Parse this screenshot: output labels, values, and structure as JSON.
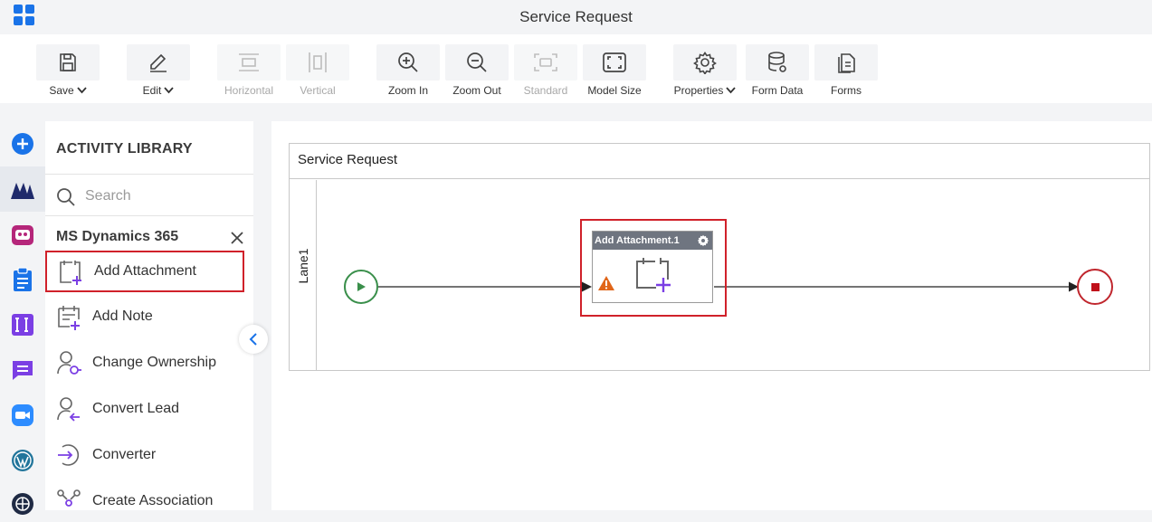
{
  "app": {
    "title": "Service Request"
  },
  "toolbar": {
    "save": "Save",
    "edit": "Edit",
    "horizontal": "Horizontal",
    "vertical": "Vertical",
    "zoom_in": "Zoom In",
    "zoom_out": "Zoom Out",
    "standard": "Standard",
    "model_size": "Model Size",
    "properties": "Properties",
    "form_data": "Form Data",
    "forms": "Forms"
  },
  "library": {
    "title": "ACTIVITY LIBRARY",
    "search_placeholder": "Search",
    "category": "MS Dynamics 365",
    "items": [
      {
        "label": "Add Attachment",
        "icon": "add-attachment-icon",
        "selected": true
      },
      {
        "label": "Add Note",
        "icon": "add-note-icon"
      },
      {
        "label": "Change Ownership",
        "icon": "change-ownership-icon"
      },
      {
        "label": "Convert Lead",
        "icon": "convert-lead-icon"
      },
      {
        "label": "Converter",
        "icon": "converter-icon"
      },
      {
        "label": "Create Association",
        "icon": "create-association-icon"
      }
    ]
  },
  "rail": {
    "icons": [
      "add-icon",
      "ms-dynamics-icon",
      "bot-icon",
      "clipboard-icon",
      "text-icon",
      "chat-icon",
      "video-icon",
      "wordpress-icon",
      "globe-icon"
    ]
  },
  "canvas": {
    "pool_title": "Service Request",
    "lane_label": "Lane1",
    "activity_title": "Add Attachment.1",
    "activity_has_warning": true
  },
  "colors": {
    "accent_blue": "#1a73e8",
    "highlight_red": "#d0212a",
    "start_green": "#3a8f4b",
    "end_red": "#c0262d",
    "purple": "#7b3fe4"
  }
}
